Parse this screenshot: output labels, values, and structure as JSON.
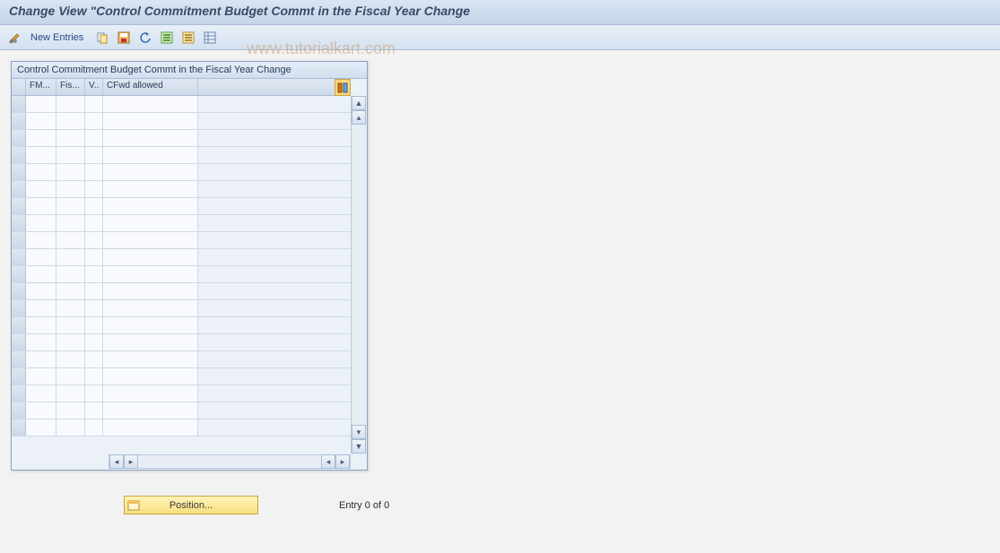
{
  "header": {
    "title": "Change View \"Control Commitment Budget Commt in the Fiscal Year Change"
  },
  "toolbar": {
    "new_entries": "New Entries"
  },
  "watermark": "www.tutorialkart.com",
  "panel": {
    "title": "Control Commitment Budget Commt in the Fiscal Year Change",
    "columns": {
      "fm": "FM...",
      "fis": "Fis...",
      "v": "V..",
      "cfwd": "CFwd allowed"
    }
  },
  "footer": {
    "position_label": "Position...",
    "entry_text": "Entry 0 of 0"
  }
}
